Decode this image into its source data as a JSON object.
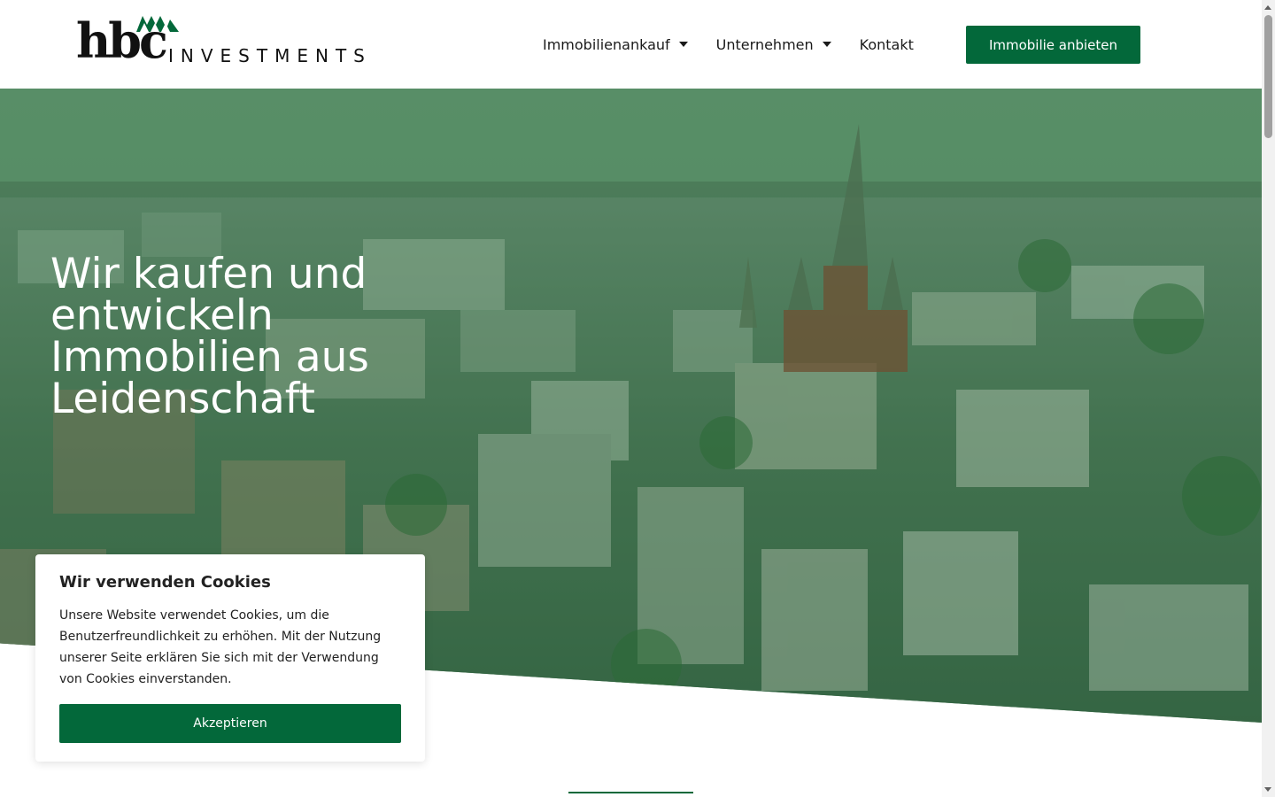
{
  "brand": {
    "logo_primary": "hbc",
    "logo_secondary": "INVESTMENTS",
    "accent_color": "#03683a"
  },
  "nav": {
    "items": [
      {
        "label": "Immobilienankauf",
        "has_dropdown": true
      },
      {
        "label": "Unternehmen",
        "has_dropdown": true
      },
      {
        "label": "Kontakt",
        "has_dropdown": false
      }
    ],
    "cta_label": "Immobilie anbieten"
  },
  "hero": {
    "title": "Wir kaufen und entwickeln Immobilien aus Leidenschaft",
    "image_description_icon": "aerial-city-photo"
  },
  "cookie_banner": {
    "title": "Wir verwenden Cookies",
    "text": "Unsere Website verwendet Cookies, um die Benutzerfreundlichkeit zu erhöhen. Mit der Nutzung unserer Seite erklären Sie sich mit der Verwendung von Cookies einverstanden.",
    "accept_label": "Akzeptieren"
  }
}
